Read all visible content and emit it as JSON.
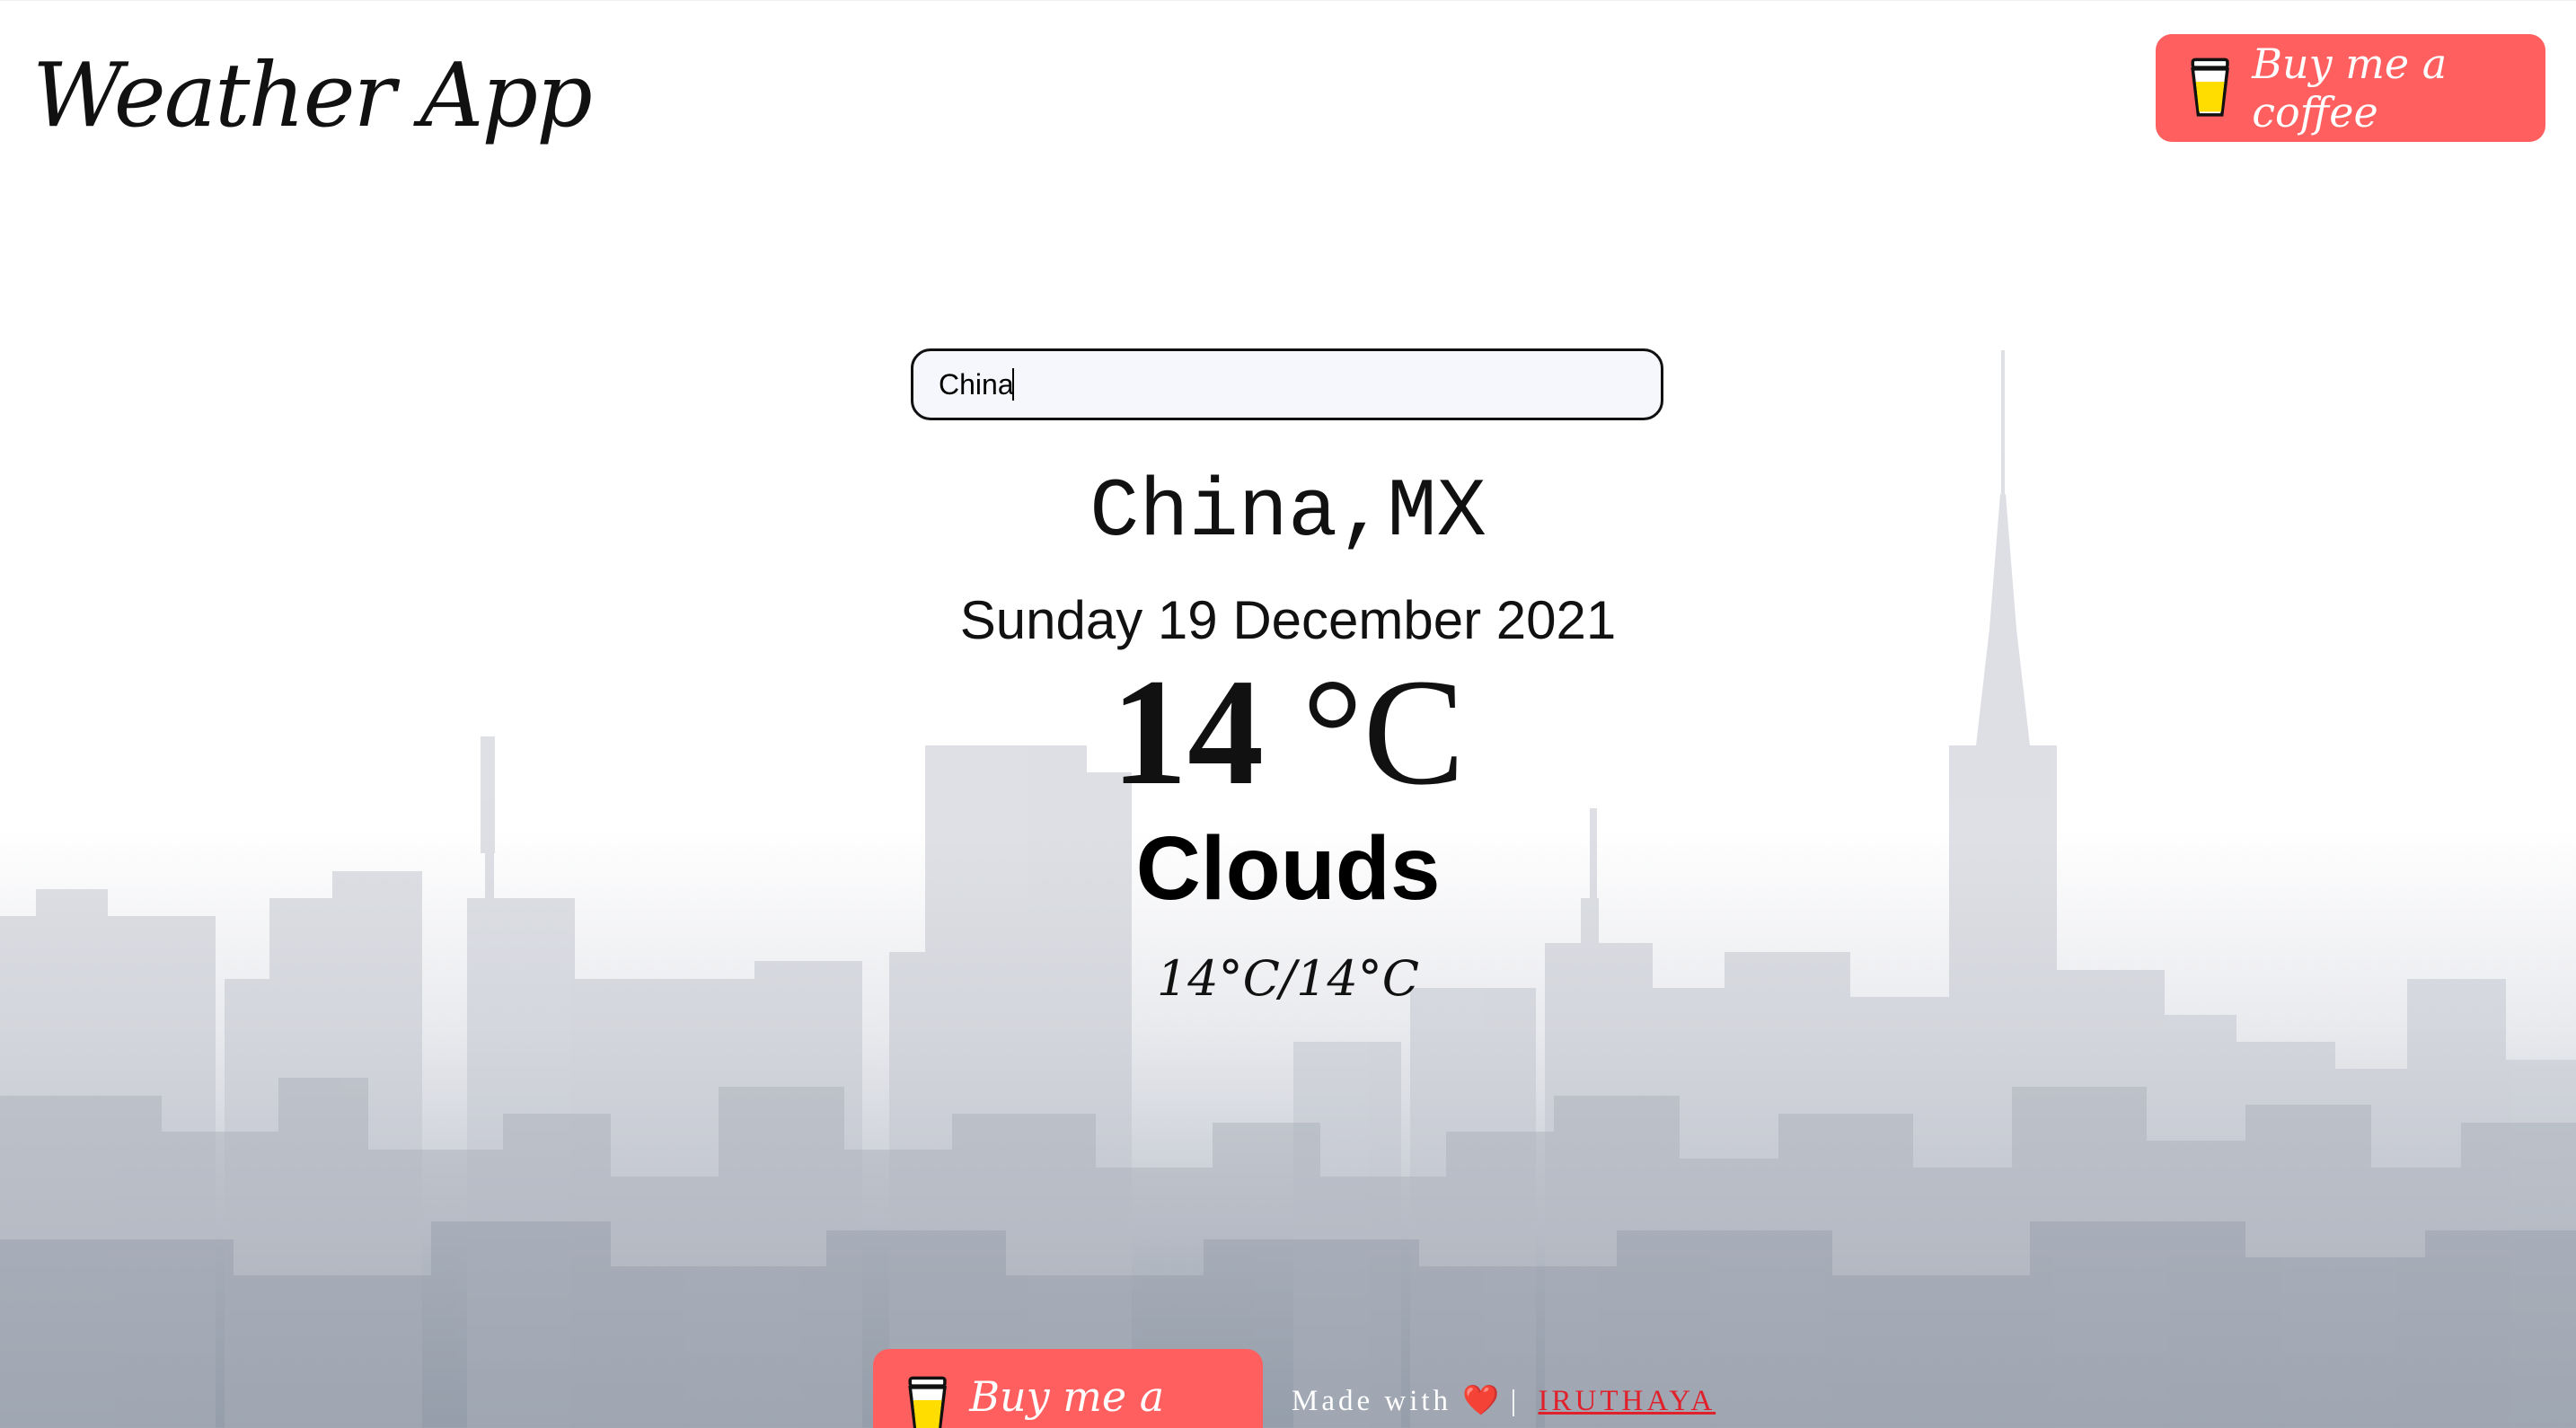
{
  "header": {
    "app_title": "Weather App",
    "coffee_button_label": "Buy me a coffee"
  },
  "search": {
    "value": "China",
    "placeholder": ""
  },
  "weather": {
    "location": "China,MX",
    "date": "Sunday 19 December 2021",
    "temperature": "14",
    "temperature_unit": "°C",
    "condition": "Clouds",
    "range": "14°C/14°C"
  },
  "footer": {
    "coffee_button_label": "Buy me a coffee",
    "made_with": "Made with",
    "heart_icon": "heart-icon",
    "separator": "|",
    "author_link": "IRUTHAYA"
  },
  "colors": {
    "coffee_button": "#ff5f5f",
    "link": "#e0202a"
  }
}
